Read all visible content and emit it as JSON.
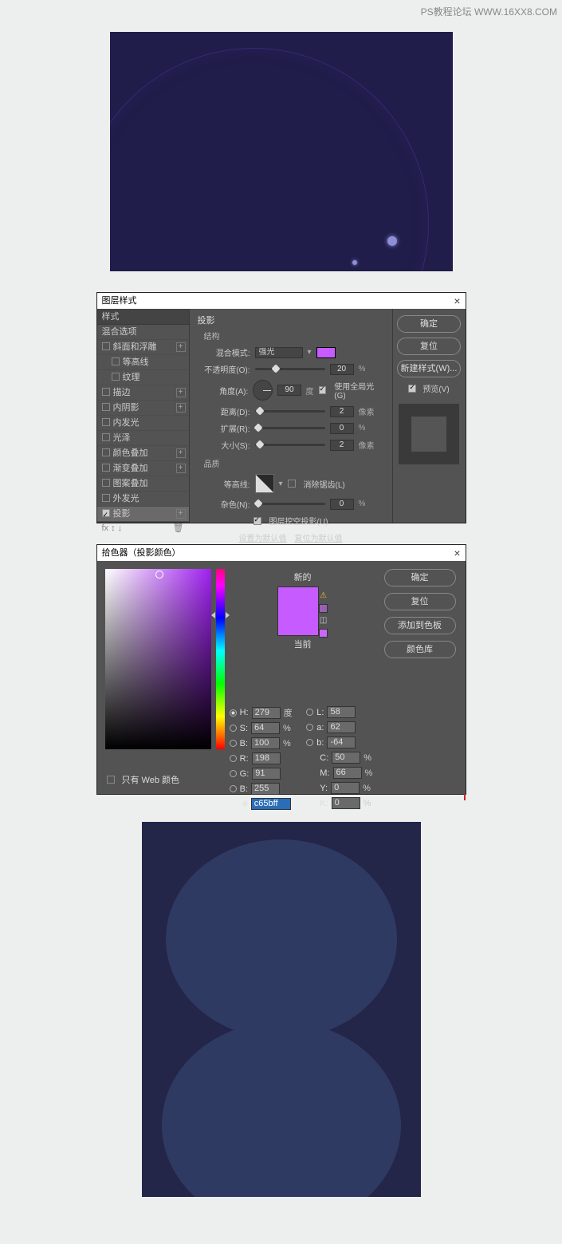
{
  "watermark": "PS教程论坛 WWW.16XX8.COM",
  "layerStyle": {
    "title": "图层样式",
    "stylesHeader": "样式",
    "items": [
      "混合选项",
      "斜面和浮雕",
      "等高线",
      "纹理",
      "描边",
      "内阴影",
      "内发光",
      "光泽",
      "颜色叠加",
      "渐变叠加",
      "图案叠加",
      "外发光",
      "投影"
    ],
    "section": "投影",
    "structure": "结构",
    "blendModeLabel": "混合模式:",
    "blendMode": "强光",
    "opacityLabel": "不透明度(O):",
    "opacity": "20",
    "angleLabel": "角度(A):",
    "angle": "90",
    "globalLight": "使用全局光(G)",
    "distanceLabel": "距离(D):",
    "distance": "2",
    "spreadLabel": "扩展(R):",
    "spread": "0",
    "sizeLabel": "大小(S):",
    "size": "2",
    "quality": "品质",
    "contourLabel": "等高线:",
    "antialias": "消除锯齿(L)",
    "noiseLabel": "杂色(N):",
    "noise": "0",
    "knockout": "图层挖空投影(U)",
    "makeDefault": "设置为默认值",
    "resetDefault": "复位为默认值",
    "ok": "确定",
    "cancel": "复位",
    "newStyle": "新建样式(W)...",
    "preview": "预览(V)",
    "deg": "度",
    "px": "像素",
    "pct": "%"
  },
  "picker": {
    "title": "拾色器（投影颜色）",
    "new": "新的",
    "current": "当前",
    "ok": "确定",
    "cancel": "复位",
    "addSwatch": "添加到色板",
    "colorLib": "颜色库",
    "webOnly": "只有 Web 颜色",
    "labels": {
      "H": "H:",
      "S": "S:",
      "B": "B:",
      "R": "R:",
      "G": "G:",
      "Bb": "B:",
      "L": "L:",
      "a": "a:",
      "b2": "b:",
      "C": "C:",
      "M": "M:",
      "Y": "Y:",
      "K": "K:",
      "hex": "#"
    },
    "vals": {
      "H": "279",
      "S": "64",
      "B": "100",
      "R": "198",
      "G": "91",
      "Bb": "255",
      "L": "58",
      "a": "62",
      "b2": "-64",
      "C": "50",
      "M": "66",
      "Y": "0",
      "K": "0",
      "hex": "c65bff"
    },
    "units": {
      "deg": "度",
      "pct": "%"
    }
  }
}
